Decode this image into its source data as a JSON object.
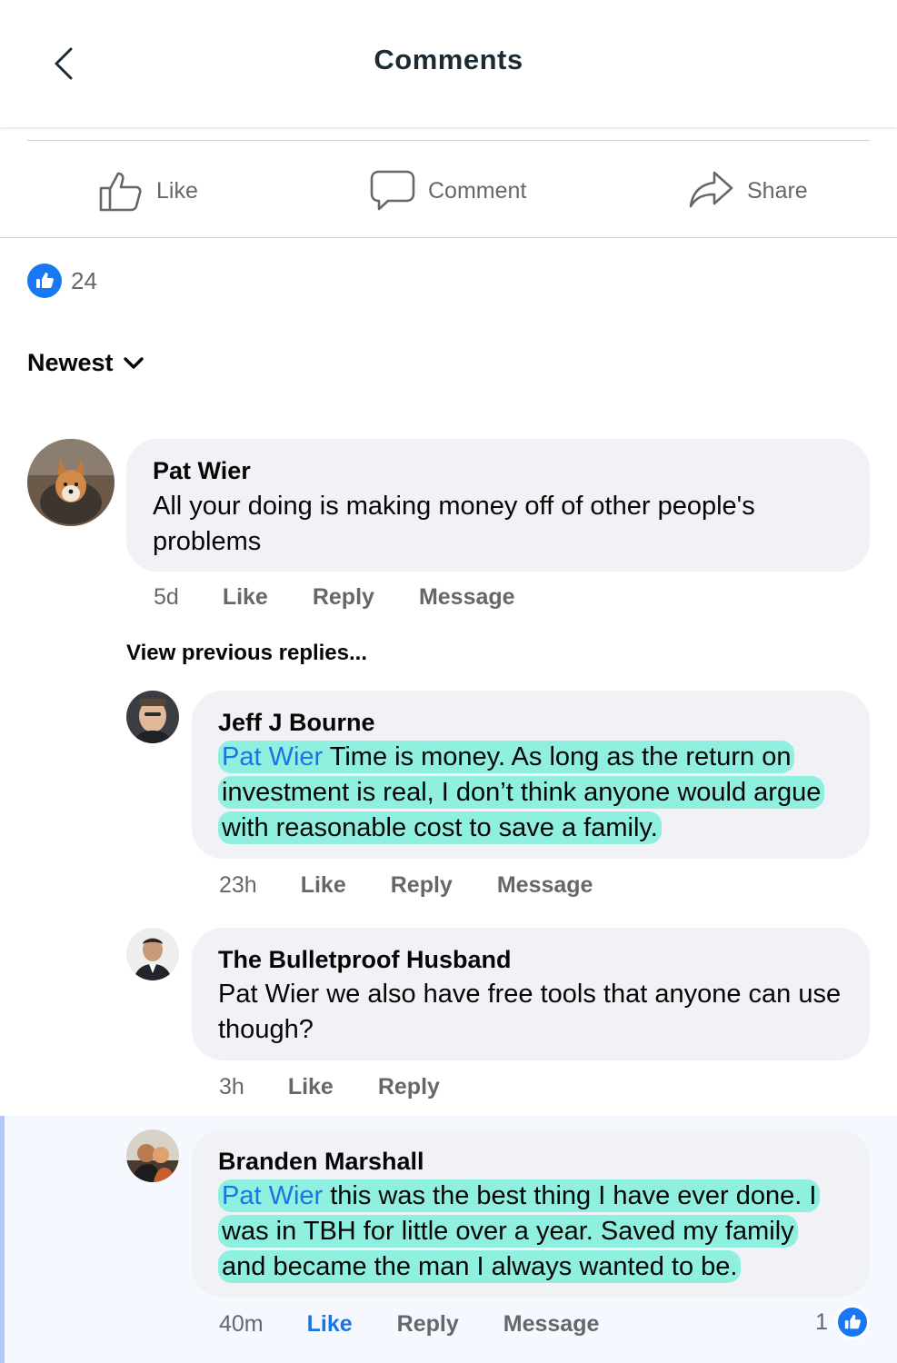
{
  "header": {
    "title": "Comments"
  },
  "post_actions": {
    "like": "Like",
    "comment": "Comment",
    "share": "Share"
  },
  "reactions": {
    "count": "24"
  },
  "sort": {
    "label": "Newest"
  },
  "comments": [
    {
      "author": "Pat Wier",
      "text": "All your doing is making money off of other people's problems",
      "time": "5d",
      "like": "Like",
      "reply": "Reply",
      "message": "Message"
    }
  ],
  "view_previous": "View previous replies...",
  "replies": [
    {
      "author": "Jeff J Bourne",
      "mention": "Pat Wier",
      "text": " Time is money. As long as the return on investment is real, I don’t think anyone would argue with reasonable cost to save a family.",
      "time": "23h",
      "like": "Like",
      "reply": "Reply",
      "message": "Message"
    },
    {
      "author": "The Bulletproof Husband",
      "text": "Pat Wier we also have free tools that anyone can use though?",
      "time": "3h",
      "like": "Like",
      "reply": "Reply"
    },
    {
      "author": "Branden Marshall",
      "mention": "Pat Wier",
      "text": " this was the best thing I have ever done. I was in TBH for little over a year. Saved my family and became the man I always wanted to be.",
      "time": "40m",
      "like": "Like",
      "reply": "Reply",
      "message": "Message",
      "reaction_count": "1"
    }
  ],
  "colors": {
    "accent": "#1877f2",
    "bubble": "#f0f2f5",
    "highlight": "#8ff0e0",
    "muted": "#65676b"
  }
}
